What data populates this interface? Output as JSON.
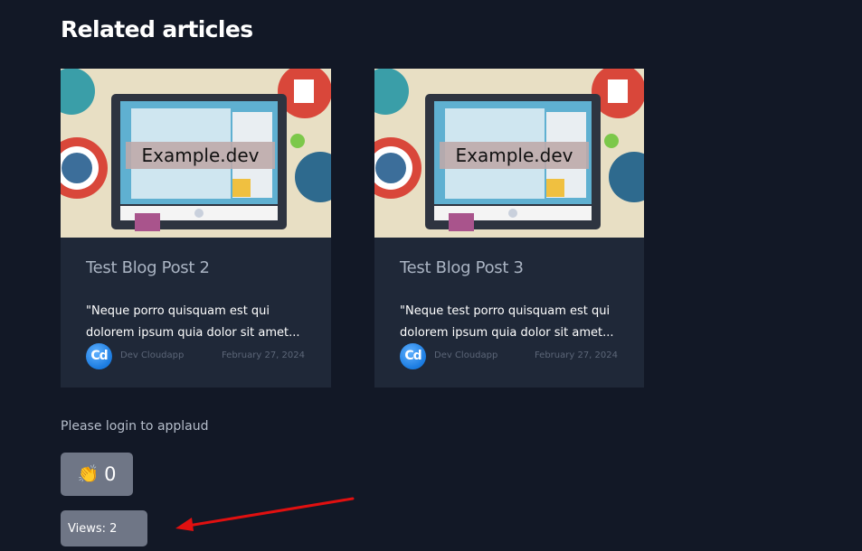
{
  "section": {
    "title": "Related articles"
  },
  "articles": [
    {
      "thumb_label": "Example.dev",
      "title": "Test Blog Post 2",
      "excerpt_line1": "\"Neque porro quisquam est qui",
      "excerpt_line2": "dolorem ipsum quia dolor sit amet...",
      "avatar_text": "Cd",
      "author": "Dev Cloudapp",
      "date": "February 27, 2024"
    },
    {
      "thumb_label": "Example.dev",
      "title": "Test Blog Post 3",
      "excerpt_line1": "\"Neque test porro quisquam est qui",
      "excerpt_line2": "dolorem ipsum quia dolor sit amet...",
      "avatar_text": "Cd",
      "author": "Dev Cloudapp",
      "date": "February 27, 2024"
    }
  ],
  "applaud": {
    "login_prompt": "Please login to applaud",
    "icon": "clapping-hands-icon",
    "count": "0"
  },
  "views": {
    "label": "Views: 2"
  },
  "colors": {
    "background": "#121826",
    "card": "#1f2838",
    "button": "#6f7686",
    "annotation_arrow": "#e01010"
  }
}
